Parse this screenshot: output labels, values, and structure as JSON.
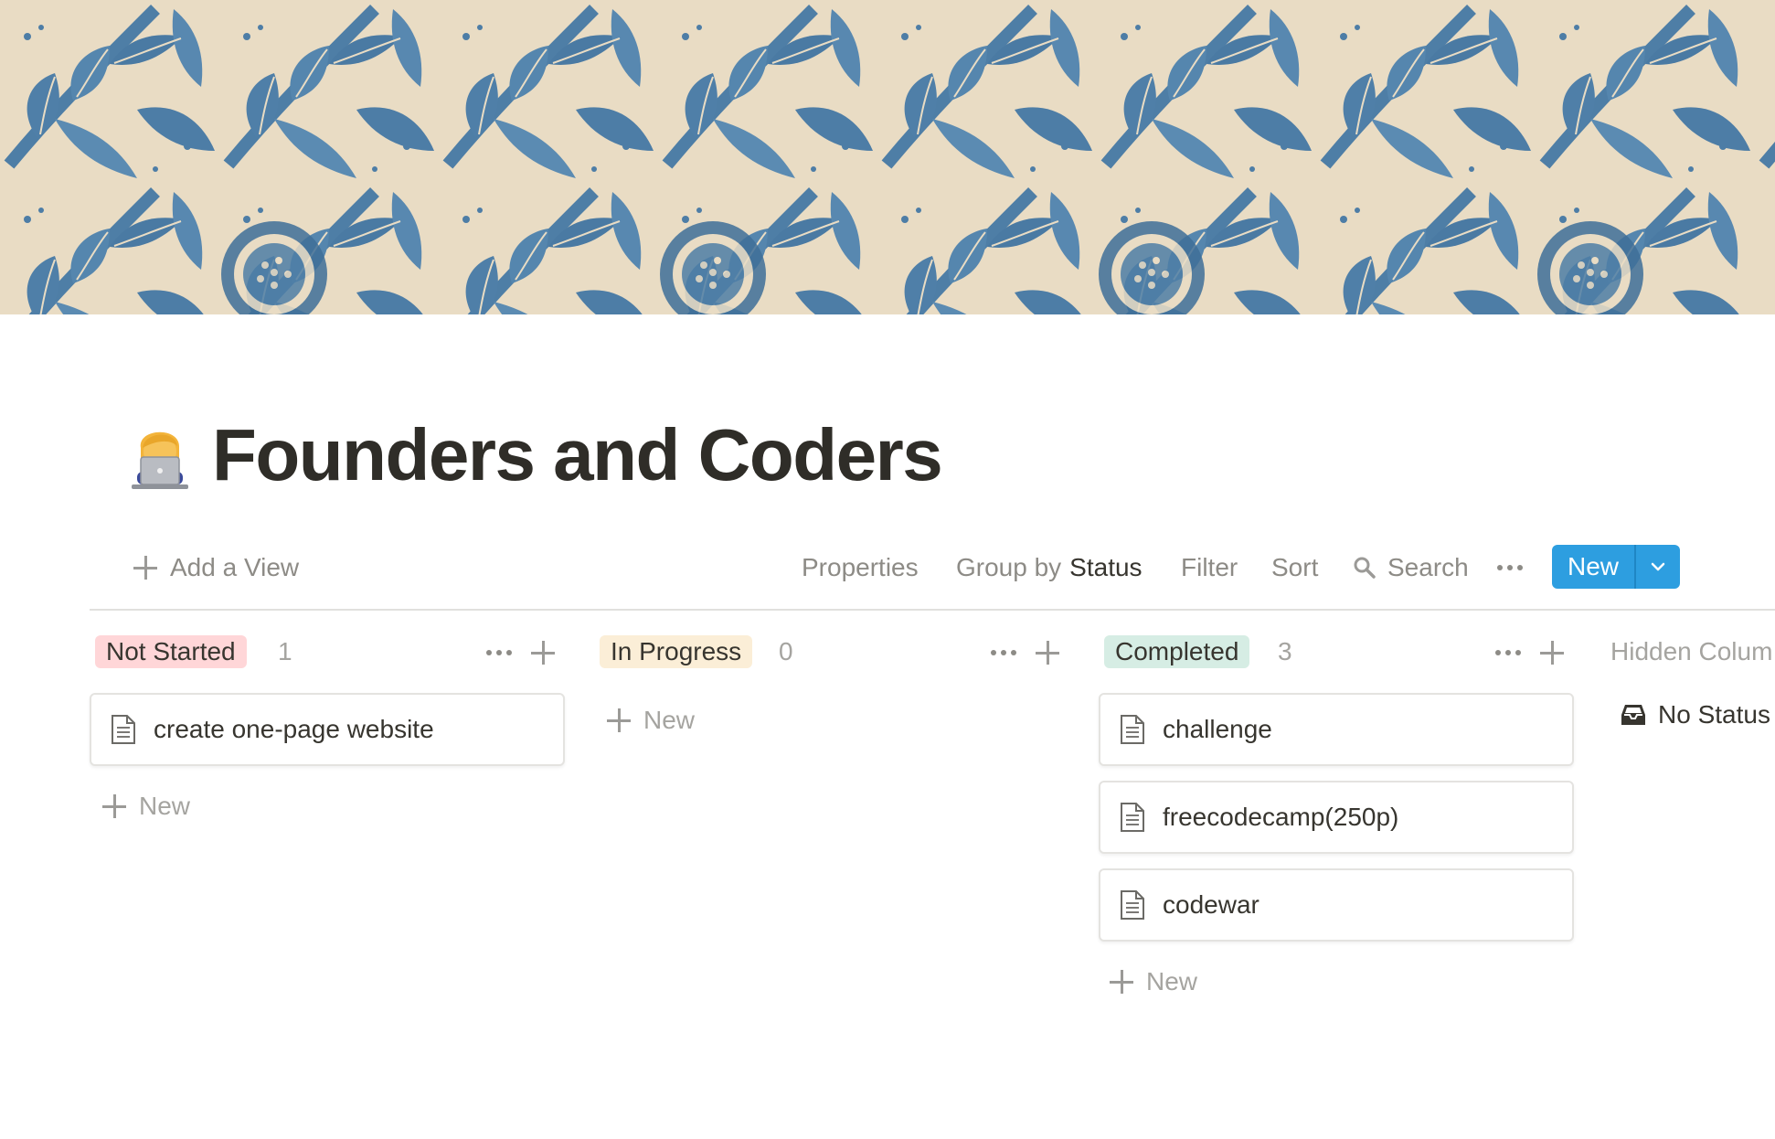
{
  "page": {
    "title": "Founders and Coders",
    "icon": "technologist-emoji-icon",
    "cover": "blue-floral-pattern"
  },
  "toolbar": {
    "add_view": "Add a View",
    "properties": "Properties",
    "group_by_prefix": "Group by",
    "group_by_value": "Status",
    "filter": "Filter",
    "sort": "Sort",
    "search": "Search",
    "new": "New"
  },
  "board": {
    "columns": [
      {
        "label": "Not Started",
        "count": "1",
        "color": "#ffd6d8",
        "cards": [
          "create one-page website"
        ],
        "add_label": "New"
      },
      {
        "label": "In Progress",
        "count": "0",
        "color": "#fbeed7",
        "cards": [],
        "add_label": "New"
      },
      {
        "label": "Completed",
        "count": "3",
        "color": "#d6ede4",
        "cards": [
          "challenge",
          "freecodecamp(250p)",
          "codewar"
        ],
        "add_label": "New"
      }
    ],
    "hidden": {
      "title": "Hidden Colum",
      "no_status": "No Status"
    }
  },
  "colors": {
    "accent": "#2d9ee0",
    "text": "#37352f",
    "muted": "#8d8b86"
  }
}
